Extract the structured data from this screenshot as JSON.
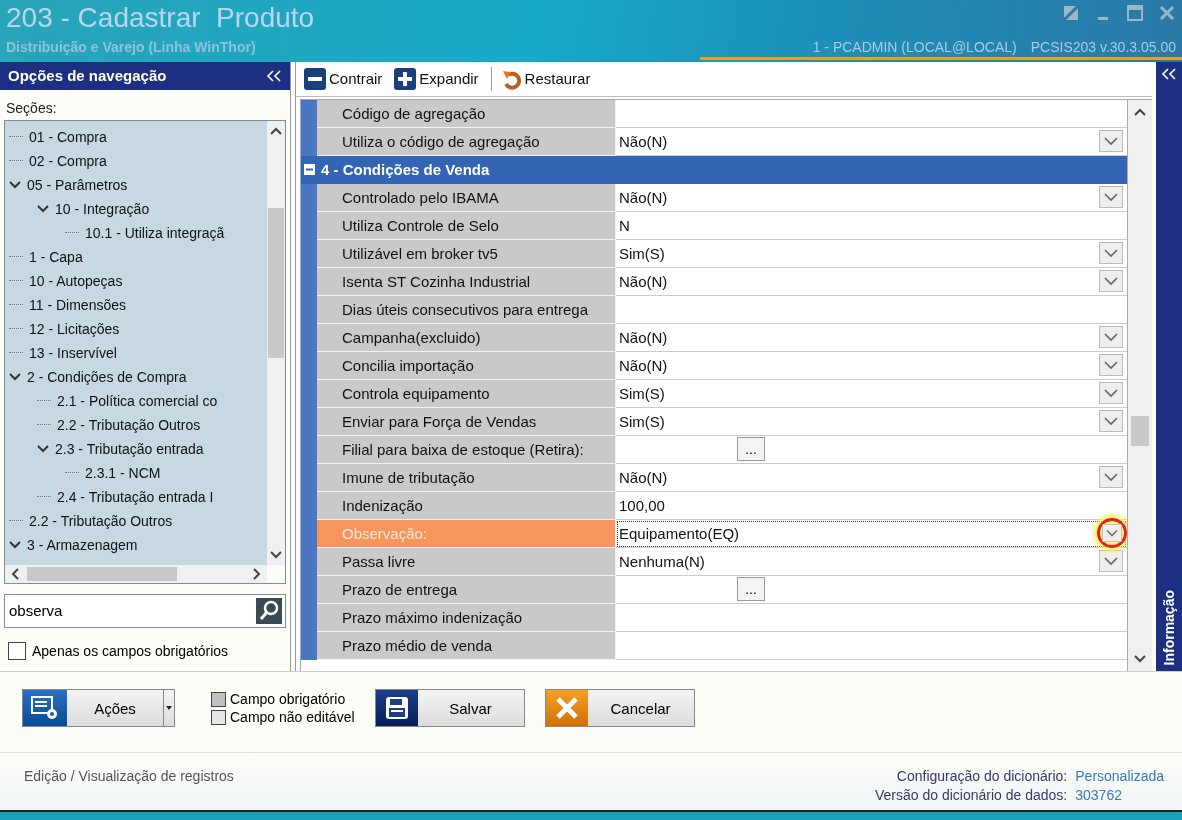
{
  "window": {
    "title": "203 - Cadastrar  Produto",
    "subtitle": "Distribuição e Varejo (Linha WinThor)",
    "session": "1 - PCADMIN (LOCAL@LOCAL)",
    "program": "PCSIS203  v.30.3.05.00"
  },
  "navigation": {
    "title": "Opções de navegação",
    "sections_label": "Seções:",
    "tree": [
      {
        "label": "01 - Compra"
      },
      {
        "label": "02 - Compra"
      },
      {
        "label": "05 - Parâmetros",
        "expanded": true,
        "children": [
          {
            "label": "10 - Integração",
            "expanded": true,
            "children": [
              {
                "label": "10.1 - Utiliza integraçã"
              }
            ]
          }
        ]
      },
      {
        "label": "1 - Capa"
      },
      {
        "label": "10 - Autopeças"
      },
      {
        "label": "11 - Dimensões"
      },
      {
        "label": "12 - Licitações"
      },
      {
        "label": "13 - Inservível"
      },
      {
        "label": "2 - Condições de Compra",
        "expanded": true,
        "children": [
          {
            "label": "2.1 - Política comercial co"
          },
          {
            "label": "2.2 - Tributação Outros"
          },
          {
            "label": "2.3 - Tributação entrada",
            "expanded": true,
            "children": [
              {
                "label": "2.3.1 - NCM"
              }
            ]
          },
          {
            "label": "2.4 - Tributação entrada I"
          }
        ]
      },
      {
        "label": "2.2 - Tributação Outros"
      },
      {
        "label": "3 - Armazenagem",
        "expanded": true
      }
    ],
    "search": {
      "value": "observa"
    },
    "required_only": {
      "label": "Apenas os campos obrigatórios",
      "checked": false
    }
  },
  "toolbar": [
    {
      "label": "Contrair",
      "kind": "collapse"
    },
    {
      "label": "Expandir",
      "kind": "expand"
    },
    {
      "label": "Restaurar",
      "kind": "restore"
    }
  ],
  "grid": {
    "rows": [
      {
        "kind": "text",
        "label": "Código de agregação",
        "selected": false
      },
      {
        "kind": "dropdown",
        "label": "Utiliza o código de agregação",
        "value": "Não(N)",
        "selected": false
      },
      {
        "kind": "section",
        "label": "4 - Condições de Venda",
        "expanded": true
      },
      {
        "kind": "dropdown",
        "label": "Controlado pelo IBAMA",
        "value": "Não(N)",
        "selected": false
      },
      {
        "kind": "text",
        "label": "Utiliza Controle de Selo",
        "value": "N",
        "selected": false
      },
      {
        "kind": "dropdown",
        "label": "Utilizável em broker tv5",
        "value": "Sim(S)",
        "selected": false
      },
      {
        "kind": "dropdown",
        "label": "Isenta ST Cozinha Industrial",
        "value": "Não(N)",
        "selected": false
      },
      {
        "kind": "text",
        "label": "Dias úteis consecutivos para entrega",
        "selected": false
      },
      {
        "kind": "dropdown",
        "label": "Campanha(excluido)",
        "value": "Não(N)",
        "selected": false
      },
      {
        "kind": "dropdown",
        "label": "Concilia importação",
        "value": "Não(N)",
        "selected": false
      },
      {
        "kind": "dropdown",
        "label": "Controla equipamento",
        "value": "Sim(S)",
        "selected": false
      },
      {
        "kind": "dropdown",
        "label": "Enviar para Força de Vendas",
        "value": "Sim(S)",
        "selected": false
      },
      {
        "kind": "lookup",
        "label": "Filial para baixa de estoque (Retira):",
        "button": "...",
        "selected": false
      },
      {
        "kind": "dropdown",
        "label": "Imune de tributação",
        "value": "Não(N)",
        "selected": false
      },
      {
        "kind": "text",
        "label": "Indenização",
        "value": "100,00",
        "selected": false
      },
      {
        "kind": "dropdown",
        "label": "Observação:",
        "value": "Equipamento(EQ)",
        "selected": true,
        "annotated": true
      },
      {
        "kind": "dropdown",
        "label": "Passa livre",
        "value": "Nenhuma(N)",
        "selected": false
      },
      {
        "kind": "lookup",
        "label": "Prazo de entrega",
        "button": "...",
        "selected": false
      },
      {
        "kind": "text",
        "label": "Prazo máximo indenização",
        "selected": false
      },
      {
        "kind": "text",
        "label": "Prazo médio de venda",
        "selected": false
      }
    ]
  },
  "side_tab": {
    "label": "Informação"
  },
  "actions": {
    "label": "Ações"
  },
  "legend": [
    {
      "label": "Campo obrigatório",
      "color": "#c0c0c0"
    },
    {
      "label": "Campo não editável",
      "color": "#e6e6e6"
    }
  ],
  "buttons": [
    {
      "label": "Salvar",
      "kind": "save"
    },
    {
      "label": "Cancelar",
      "kind": "cancel"
    }
  ],
  "status": "Edição / Visualização de registros",
  "dictionary": [
    {
      "label": "Configuração do dicionário:",
      "value": "Personalizada"
    },
    {
      "label": "Versão do dicionário de dados:",
      "value": "303762"
    }
  ]
}
